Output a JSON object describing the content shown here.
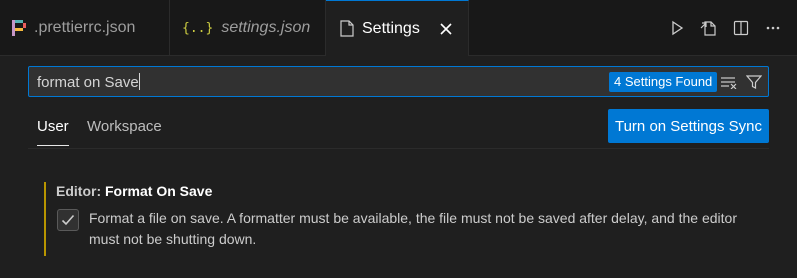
{
  "tabs": [
    {
      "label": ".prettierrc.json",
      "icon": "prettier-icon",
      "active": false
    },
    {
      "label": "settings.json",
      "icon": "json-braces-icon",
      "active": false
    },
    {
      "label": "Settings",
      "icon": "file-icon",
      "active": true
    }
  ],
  "search": {
    "value": "format on Save",
    "results_badge": "4 Settings Found"
  },
  "scope_tabs": [
    {
      "label": "User",
      "active": true
    },
    {
      "label": "Workspace",
      "active": false
    }
  ],
  "sync_button_label": "Turn on Settings Sync",
  "setting": {
    "category": "Editor: ",
    "name": "Format On Save",
    "checked": true,
    "description": "Format a file on save. A formatter must be available, the file must not be saved after delay, and the editor must not be shutting down."
  },
  "colors": {
    "accent": "#0078d4",
    "modified_indicator": "#b89500",
    "prettier_icon": "#c596c7",
    "json_icon": "#cbcb41"
  }
}
